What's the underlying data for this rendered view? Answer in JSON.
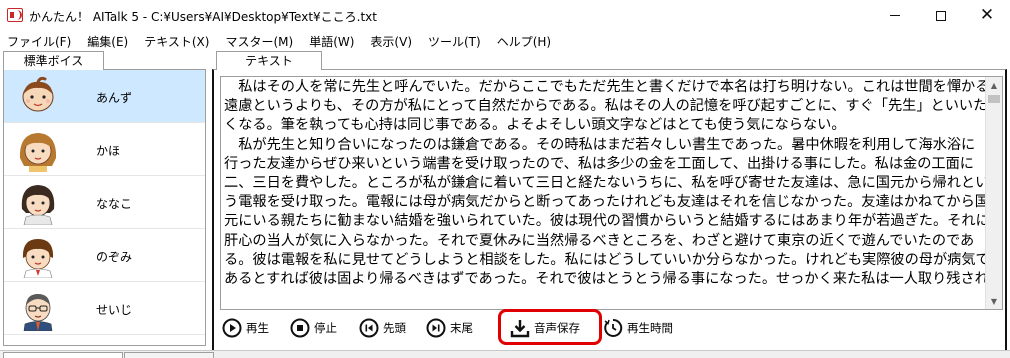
{
  "window": {
    "title": "かんたん！ AITalk 5 - C:¥Users¥AI¥Desktop¥Text¥こころ.txt",
    "minimize": "—",
    "maximize": "□",
    "close": "✕"
  },
  "menu": [
    {
      "label": "ファイル(F)"
    },
    {
      "label": "編集(E)"
    },
    {
      "label": "テキスト(X)"
    },
    {
      "label": "マスター(M)"
    },
    {
      "label": "単語(W)"
    },
    {
      "label": "表示(V)"
    },
    {
      "label": "ツール(T)"
    },
    {
      "label": "ヘルプ(H)"
    }
  ],
  "voice_panel": {
    "tab_label": "標準ボイス",
    "voices": [
      {
        "name": "あんず",
        "selected": true,
        "icon": "avatar-anzu"
      },
      {
        "name": "かほ",
        "selected": false,
        "icon": "avatar-kaho"
      },
      {
        "name": "ななこ",
        "selected": false,
        "icon": "avatar-nanako"
      },
      {
        "name": "のぞみ",
        "selected": false,
        "icon": "avatar-nozomi"
      },
      {
        "name": "せいじ",
        "selected": false,
        "icon": "avatar-seiji"
      }
    ]
  },
  "text_panel": {
    "tab_label": "テキスト",
    "content": "　私はその人を常に先生と呼んでいた。だからここでもただ先生と書くだけで本名は打ち明けない。これは世間を憚かる\n遠慮というよりも、その方が私にとって自然だからである。私はその人の記憶を呼び起すごとに、すぐ「先生」といいた\nくなる。筆を執っても心持は同じ事である。よそよそしい頭文字などはとても使う気にならない。\n　私が先生と知り合いになったのは鎌倉である。その時私はまだ若々しい書生であった。暑中休暇を利用して海水浴に\n行った友達からぜひ来いという端書を受け取ったので、私は多少の金を工面して、出掛ける事にした。私は金の工面に\n二、三日を費やした。ところが私が鎌倉に着いて三日と経たないうちに、私を呼び寄せた友達は、急に国元から帰れとい\nう電報を受け取った。電報には母が病気だからと断ってあったけれども友達はそれを信じなかった。友達はかねてから国\n元にいる親たちに勧まない結婚を強いられていた。彼は現代の習慣からいうと結婚するにはあまり年が若過ぎた。それに\n肝心の当人が気に入らなかった。それで夏休みに当然帰るべきところを、わざと避けて東京の近くで遊んでいたのであ\nる。彼は電報を私に見せてどうしようと相談をした。私にはどうしていいか分らなかった。けれども実際彼の母が病気で\nあるとすれば彼は固より帰るべきはずであった。それで彼はとうとう帰る事になった。せっかく来た私は一人取り残され"
  },
  "controls": {
    "play": "再生",
    "stop": "停止",
    "head": "先頭",
    "end": "末尾",
    "save_audio": "音声保存",
    "play_time": "再生時間"
  },
  "colors": {
    "selection": "#cde8ff",
    "highlight": "#e00000",
    "border": "#9e9e9e"
  }
}
